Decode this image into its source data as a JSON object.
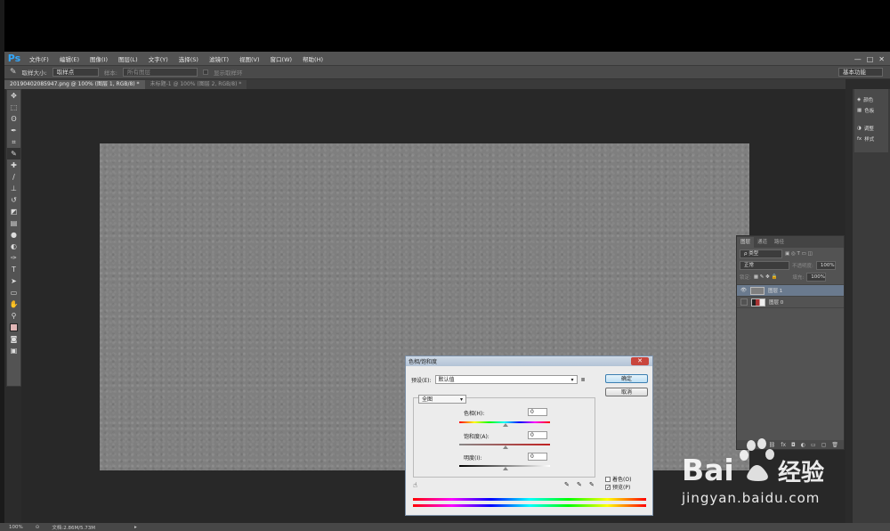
{
  "app": {
    "logo": "Ps"
  },
  "menu": [
    "文件(F)",
    "编辑(E)",
    "图像(I)",
    "图层(L)",
    "文字(Y)",
    "选择(S)",
    "滤镜(T)",
    "视图(V)",
    "窗口(W)",
    "帮助(H)"
  ],
  "window_controls": {
    "minimize": "—",
    "maximize": "□",
    "close": "✕"
  },
  "options_bar": {
    "sample_size_label": "取样大小:",
    "sample_size_value": "取样点",
    "sample_label": "样本:",
    "sample_value": "所有图层",
    "show_ring_label": "显示取样环",
    "workspace": "基本功能"
  },
  "tabs": [
    {
      "label": "20190402085947.png @ 100% (图层 1, RGB/8) *",
      "active": true
    },
    {
      "label": "未标题-1 @ 100% (图层 2, RGB/8) *",
      "active": false
    }
  ],
  "tools": [
    "move-icon",
    "marquee-icon",
    "lasso-icon",
    "quick-select-icon",
    "crop-icon",
    "eyedropper-icon",
    "healing-icon",
    "brush-icon",
    "stamp-icon",
    "history-brush-icon",
    "eraser-icon",
    "gradient-icon",
    "blur-icon",
    "dodge-icon",
    "pen-icon",
    "type-icon",
    "path-select-icon",
    "shape-icon",
    "hand-icon",
    "zoom-icon"
  ],
  "right_panels": [
    {
      "icon": "color-icon",
      "label": "颜色"
    },
    {
      "icon": "swatches-icon",
      "label": "色板"
    },
    {
      "icon": "adjustments-icon",
      "label": "调整"
    },
    {
      "icon": "styles-icon",
      "label": "样式"
    }
  ],
  "layers_panel": {
    "tabs": [
      "图层",
      "通道",
      "路径"
    ],
    "filter_label": "ρ 类型",
    "blend_mode": "正常",
    "opacity_label": "不透明度:",
    "opacity_value": "100%",
    "lock_label": "锁定:",
    "fill_label": "填充:",
    "fill_value": "100%",
    "layers": [
      {
        "name": "图层 1",
        "selected": true,
        "visible": true
      },
      {
        "name": "图层 0",
        "selected": false,
        "visible": false
      }
    ]
  },
  "status": {
    "zoom": "100%",
    "doc": "文档:2.86M/5.73M"
  },
  "dialog": {
    "title": "色相/饱和度",
    "preset_label": "预设(E):",
    "preset_value": "默认值",
    "ok": "确定",
    "cancel": "取消",
    "channel": "全图",
    "hue_label": "色相(H):",
    "hue_value": "0",
    "saturation_label": "饱和度(A):",
    "saturation_value": "0",
    "lightness_label": "明度(I):",
    "lightness_value": "0",
    "colorize_label": "着色(O)",
    "preview_label": "预览(P)",
    "colorize_checked": false,
    "preview_checked": true
  },
  "watermark": {
    "brand_left": "Bai",
    "brand_right": "经验",
    "url": "jingyan.baidu.com"
  }
}
